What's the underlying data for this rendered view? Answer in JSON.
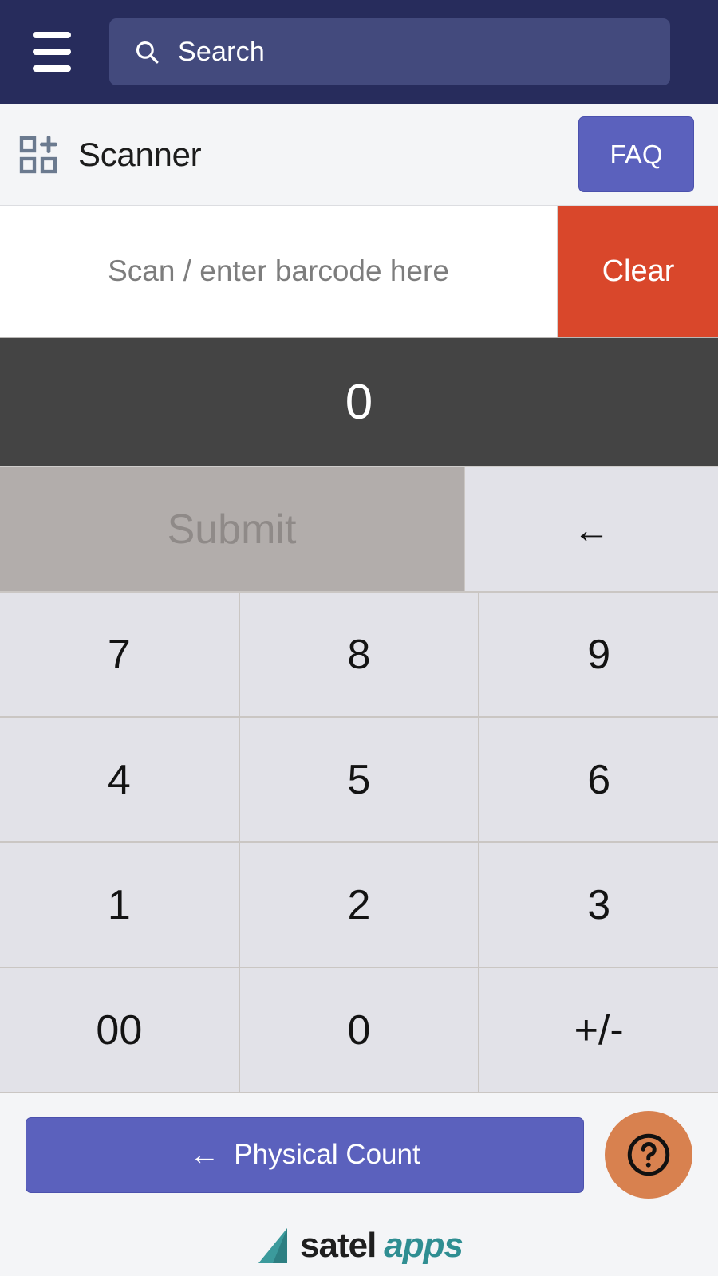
{
  "topnav": {
    "menu_icon": "hamburger-menu-icon",
    "search": {
      "icon": "search-icon",
      "placeholder": "Search",
      "value": ""
    },
    "background_color": "#272c5c",
    "search_background_color": "#434a7d"
  },
  "titlebar": {
    "icon": "add-to-grid-icon",
    "title": "Scanner",
    "faq_label": "FAQ",
    "faq_color": "#5b61bd"
  },
  "scanner": {
    "input_placeholder": "Scan / enter barcode here",
    "input_value": "",
    "clear_label": "Clear",
    "clear_color": "#d9472b"
  },
  "display": {
    "value": "0",
    "background_color": "#444444",
    "text_color": "#ffffff"
  },
  "keypad": {
    "submit_label": "Submit",
    "submit_enabled": false,
    "submit_background_color": "#b2adab",
    "submit_text_color": "#8f8a88",
    "backspace_label": "←",
    "key_background_color": "#e2e2e8",
    "rows": [
      [
        "7",
        "8",
        "9"
      ],
      [
        "4",
        "5",
        "6"
      ],
      [
        "1",
        "2",
        "3"
      ],
      [
        "00",
        "0",
        "+/-"
      ]
    ]
  },
  "footer": {
    "physical_count_label": "Physical Count",
    "physical_count_arrow": "←",
    "physical_count_color": "#5b61bd",
    "help_icon": "question-mark-circle-icon",
    "help_color": "#d8814f",
    "brand": {
      "name_primary": "satel",
      "name_secondary": "apps",
      "primary_color": "#1f1f1f",
      "secondary_color": "#2f8e92",
      "mark_color": "#3b9a9c"
    }
  }
}
